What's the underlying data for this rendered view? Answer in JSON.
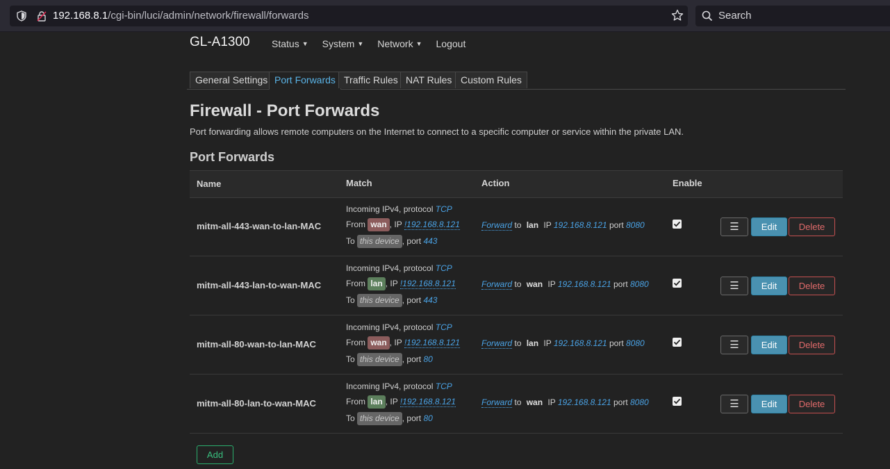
{
  "browser": {
    "url_host": "192.168.8.1",
    "url_path": "/cgi-bin/luci/admin/network/firewall/forwards",
    "search_placeholder": "Search"
  },
  "header": {
    "brand": "GL-A1300",
    "menu": [
      {
        "label": "Status",
        "dropdown": true
      },
      {
        "label": "System",
        "dropdown": true
      },
      {
        "label": "Network",
        "dropdown": true
      },
      {
        "label": "Logout",
        "dropdown": false
      }
    ]
  },
  "tabs": [
    {
      "label": "General Settings",
      "active": false
    },
    {
      "label": "Port Forwards",
      "active": true
    },
    {
      "label": "Traffic Rules",
      "active": false
    },
    {
      "label": "NAT Rules",
      "active": false
    },
    {
      "label": "Custom Rules",
      "active": false
    }
  ],
  "page": {
    "title": "Firewall - Port Forwards",
    "description": "Port forwarding allows remote computers on the Internet to connect to a specific computer or service within the private LAN.",
    "section_title": "Port Forwards"
  },
  "table": {
    "headers": {
      "name": "Name",
      "match": "Match",
      "action": "Action",
      "enable": "Enable"
    },
    "rows": [
      {
        "name": "mitm-all-443-wan-to-lan-MAC",
        "match_incoming": "Incoming IPv4, protocol",
        "protocol": "TCP",
        "from_zone": "wan",
        "from_ip": "!192.168.8.121",
        "to_dest": "this device",
        "to_port": "443",
        "action": "Forward",
        "action_zone": "lan",
        "action_ip": "192.168.8.121",
        "action_port": "8080",
        "enabled": true
      },
      {
        "name": "mitm-all-443-lan-to-wan-MAC",
        "match_incoming": "Incoming IPv4, protocol",
        "protocol": "TCP",
        "from_zone": "lan",
        "from_ip": "!192.168.8.121",
        "to_dest": "this device",
        "to_port": "443",
        "action": "Forward",
        "action_zone": "wan",
        "action_ip": "192.168.8.121",
        "action_port": "8080",
        "enabled": true
      },
      {
        "name": "mitm-all-80-wan-to-lan-MAC",
        "match_incoming": "Incoming IPv4, protocol",
        "protocol": "TCP",
        "from_zone": "wan",
        "from_ip": "!192.168.8.121",
        "to_dest": "this device",
        "to_port": "80",
        "action": "Forward",
        "action_zone": "lan",
        "action_ip": "192.168.8.121",
        "action_port": "8080",
        "enabled": true
      },
      {
        "name": "mitm-all-80-lan-to-wan-MAC",
        "match_incoming": "Incoming IPv4, protocol",
        "protocol": "TCP",
        "from_zone": "lan",
        "from_ip": "!192.168.8.121",
        "to_dest": "this device",
        "to_port": "80",
        "action": "Forward",
        "action_zone": "wan",
        "action_ip": "192.168.8.121",
        "action_port": "8080",
        "enabled": true
      }
    ],
    "labels": {
      "from": "From",
      "ip": ", IP",
      "to": "To",
      "port": ", port",
      "to_word": "to",
      "ip_word": "IP",
      "port_word": "port",
      "menu_glyph": "☰",
      "edit": "Edit",
      "delete": "Delete"
    }
  },
  "add_label": "Add",
  "colors": {
    "wan_zone": "#8c5c5c",
    "lan_zone": "#5c7f5c",
    "link": "#4aa3e6",
    "active_tab": "#5ab3e6"
  }
}
